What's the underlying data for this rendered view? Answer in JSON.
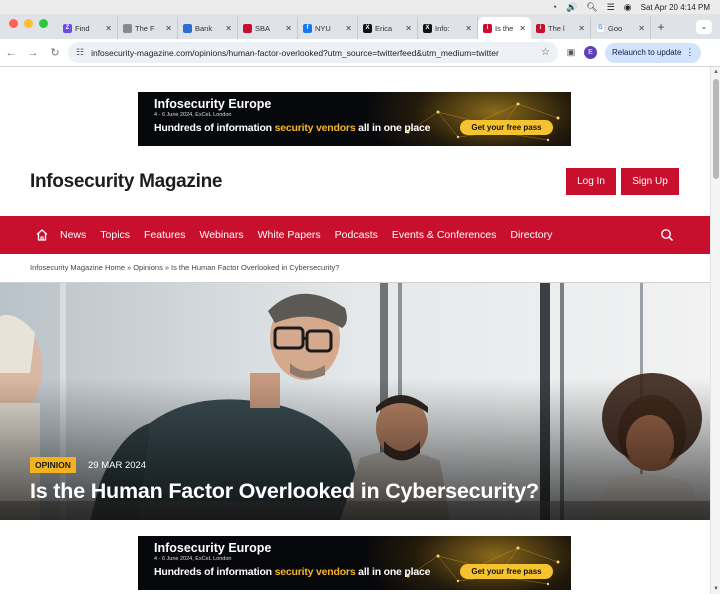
{
  "menubar": {
    "datetime": "Sat Apr 20  4:14 PM"
  },
  "tabs": [
    {
      "label": "Find",
      "favicon_color": "#6b4ce6",
      "favicon_glyph": "Z"
    },
    {
      "label": "The F",
      "favicon_color": "#8a8a8a",
      "favicon_glyph": ""
    },
    {
      "label": "Bank",
      "favicon_color": "#2d6fd0",
      "favicon_glyph": ""
    },
    {
      "label": "SBA",
      "favicon_color": "#c8102e",
      "favicon_glyph": ""
    },
    {
      "label": "NYU",
      "favicon_color": "#1877f2",
      "favicon_glyph": "f"
    },
    {
      "label": "Erica",
      "favicon_color": "#111111",
      "favicon_glyph": "X"
    },
    {
      "label": "Info:",
      "favicon_color": "#111111",
      "favicon_glyph": "X"
    },
    {
      "label": "Is the",
      "favicon_color": "#c8102e",
      "favicon_glyph": "i",
      "active": true
    },
    {
      "label": "The l",
      "favicon_color": "#c8102e",
      "favicon_glyph": "i"
    },
    {
      "label": "Goo",
      "favicon_color": "#ffffff",
      "favicon_glyph": "G"
    }
  ],
  "toolbar": {
    "url": "infosecurity-magazine.com/opinions/human-factor-overlooked?utm_source=twitterfeed&utm_medium=twitter",
    "profile_initial": "E",
    "relaunch_label": "Relaunch to update"
  },
  "banner": {
    "brand": "Infosecurity Europe",
    "dates": "4 - 6 June 2024, ExCeL London",
    "headline_start": "Hundreds of information ",
    "headline_highlight": "security vendors",
    "headline_end": " all in one place",
    "cta": "Get your free pass"
  },
  "site": {
    "logo": "Infosecurity Magazine",
    "login_label": "Log In",
    "signup_label": "Sign Up",
    "nav": [
      "News",
      "Topics",
      "Features",
      "Webinars",
      "White Papers",
      "Podcasts",
      "Events & Conferences",
      "Directory"
    ]
  },
  "breadcrumb": {
    "home": "Infosecurity Magazine Home",
    "section": "Opinions",
    "current": "Is the Human Factor Overlooked in Cybersecurity?"
  },
  "article": {
    "category": "OPINION",
    "date": "29 MAR 2024",
    "title": "Is the Human Factor Overlooked in Cybersecurity?"
  },
  "colors": {
    "brand_red": "#c8102e",
    "badge_yellow": "#f3b321",
    "banner_gold": "#f5b522"
  }
}
